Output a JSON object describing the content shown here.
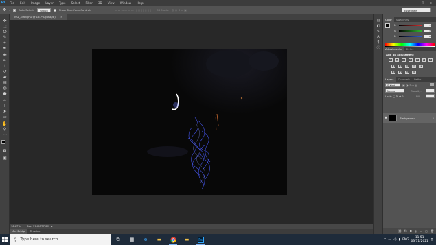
{
  "app": {
    "logo": "Ps",
    "menu": [
      "File",
      "Edit",
      "Image",
      "Layer",
      "Type",
      "Select",
      "Filter",
      "3D",
      "View",
      "Window",
      "Help"
    ],
    "window_controls": [
      "—",
      "❐",
      "✕"
    ]
  },
  "options_bar": {
    "auto_select_label": "Auto-Select:",
    "auto_select_value": "Group",
    "show_transform_label": "Show Transform Controls",
    "mode_3d_label": "3D Mode:",
    "workspace": "Essentials"
  },
  "document": {
    "tab_title": "IMG_3465.JPG @ 16.7% (RGB/8)",
    "close_glyph": "×"
  },
  "status_bar": {
    "zoom": "16.67%",
    "doc_info": "Doc: 57.0M/57.0M"
  },
  "bottom_tabs": [
    "Mini Bridge",
    "Timeline"
  ],
  "color_panel": {
    "tabs": [
      "Color",
      "Swatches"
    ],
    "channels": [
      {
        "label": "R",
        "value": "7",
        "color": "#e03030"
      },
      {
        "label": "G",
        "value": "7",
        "color": "#30c030"
      },
      {
        "label": "B",
        "value": "6",
        "color": "#3060e0"
      }
    ]
  },
  "adjustments_panel": {
    "tabs": [
      "Adjustments",
      "Styles"
    ],
    "heading": "Add an adjustment"
  },
  "layers_panel": {
    "tabs": [
      "Layers",
      "Channels",
      "Paths"
    ],
    "kind_label": "Kind",
    "blend_mode": "Normal",
    "opacity_label": "Opacity:",
    "lock_label": "Lock:",
    "fill_label": "Fill:",
    "layer_name": "Background"
  },
  "taskbar": {
    "search_placeholder": "Type here to search",
    "time": "11:51",
    "date": "03/11/2021",
    "lang": "ENG"
  },
  "colors": {
    "accent_blue": "#31a8ff",
    "panel_bg": "#535353",
    "canvas_bg": "#282828"
  }
}
